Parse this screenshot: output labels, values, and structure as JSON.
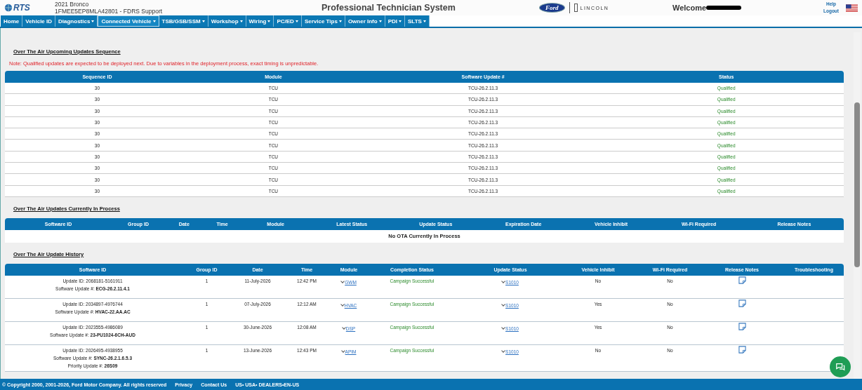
{
  "header": {
    "logo": "RTS",
    "vehicle": "2021 Bronco",
    "vin_line": "1FMEE5EP8MLA42801 - FDRS Support",
    "title": "Professional Technician System",
    "brand_1": "Ford",
    "brand_2": "LINCOLN",
    "welcome": "Welcome",
    "links": [
      "Help",
      "Logout"
    ]
  },
  "nav": [
    {
      "label": "Home",
      "has_menu": false,
      "selected": false
    },
    {
      "label": "Vehicle ID",
      "has_menu": false,
      "selected": false
    },
    {
      "label": "Diagnostics",
      "has_menu": true,
      "selected": false
    },
    {
      "label": "Connected Vehicle",
      "has_menu": true,
      "selected": true
    },
    {
      "label": "TSB/GSB/SSM",
      "has_menu": true,
      "selected": false
    },
    {
      "label": "Workshop",
      "has_menu": true,
      "selected": false
    },
    {
      "label": "Wiring",
      "has_menu": true,
      "selected": false
    },
    {
      "label": "PC/ED",
      "has_menu": true,
      "selected": false
    },
    {
      "label": "Service Tips",
      "has_menu": true,
      "selected": false
    },
    {
      "label": "Owner Info",
      "has_menu": true,
      "selected": false
    },
    {
      "label": "PDI",
      "has_menu": true,
      "selected": false
    },
    {
      "label": "SLTS",
      "has_menu": true,
      "selected": false
    }
  ],
  "upcoming": {
    "heading": "Over The Air Upcoming Updates Sequence",
    "note": "Note: Qualified updates are expected to be deployed next. Due to variables in the deployment process, exact timing is unpredictable.",
    "columns": [
      "Sequence ID",
      "Module",
      "Software Update #",
      "Status"
    ],
    "rows": [
      [
        "30",
        "TCU",
        "TCU-26.2.11.3",
        "Qualified"
      ],
      [
        "30",
        "TCU",
        "TCU-26.2.11.3",
        "Qualified"
      ],
      [
        "30",
        "TCU",
        "TCU-26.2.11.3",
        "Qualified"
      ],
      [
        "30",
        "TCU",
        "TCU-26.2.11.3",
        "Qualified"
      ],
      [
        "30",
        "TCU",
        "TCU-26.2.11.3",
        "Qualified"
      ],
      [
        "30",
        "TCU",
        "TCU-26.2.11.3",
        "Qualified"
      ],
      [
        "30",
        "TCU",
        "TCU-26.2.11.3",
        "Qualified"
      ],
      [
        "30",
        "TCU",
        "TCU-26.2.11.3",
        "Qualified"
      ],
      [
        "30",
        "TCU",
        "TCU-26.2.11.3",
        "Qualified"
      ],
      [
        "30",
        "TCU",
        "TCU-26.2.11.3",
        "Qualified"
      ]
    ]
  },
  "in_process": {
    "heading": "Over The Air Updates Currently In Process",
    "columns": [
      "Software ID",
      "Group ID",
      "Date",
      "Time",
      "Module",
      "Latest Status",
      "Update Status",
      "Expiration Date",
      "Vehicle Inhibit",
      "Wi-Fi Required",
      "Release Notes"
    ],
    "empty_message": "No OTA Currently In Process"
  },
  "history": {
    "heading": "Over The Air Update History",
    "columns": [
      "Software ID",
      "Group ID",
      "Date",
      "Time",
      "Module",
      "Completion Status",
      "Update Status",
      "Vehicle Inhibit",
      "Wi-Fi Required",
      "Release Notes",
      "Troubleshooting"
    ],
    "rows": [
      {
        "software": [
          "Update ID: 2068181-5161911",
          "Software Update #: **ECG-26.2.11.4.1**"
        ],
        "group": "1",
        "date": "11-July-2026",
        "time": "12:42 PM",
        "module": "GWM",
        "completion": "Campaign Successful",
        "update_status": "S1010",
        "inhibit": "No",
        "wifi": "No"
      },
      {
        "software": [
          "Update ID: 2034897-4976744",
          "Software Update #: **HVAC-22.AA.AC**"
        ],
        "group": "1",
        "date": "07-July-2026",
        "time": "12:12 AM",
        "module": "HVAC",
        "completion": "Campaign Successful",
        "update_status": "S1010",
        "inhibit": "Yes",
        "wifi": "No"
      },
      {
        "software": [
          "Update ID: 2023555-4986089",
          "Software Update #: **23-PU1024-6CH-AUD**"
        ],
        "group": "1",
        "date": "30-June-2026",
        "time": "12:08 AM",
        "module": "DSP",
        "completion": "Campaign Successful",
        "update_status": "S1010",
        "inhibit": "Yes",
        "wifi": "No"
      },
      {
        "software": [
          "Update ID: 2026495-4938955",
          "Software Update #: **SYNC-26.2.1.6.5.3**",
          "Priority Update #: **26S09**"
        ],
        "group": "1",
        "date": "13-June-2026",
        "time": "12:43 PM",
        "module": "APIM",
        "completion": "Campaign Successful",
        "update_status": "S1010",
        "inhibit": "No",
        "wifi": "No"
      }
    ]
  },
  "footer": {
    "copyright": "© Copyright 2000, 2001-2026, Ford Motor Company. All rights reserved",
    "links": [
      "Privacy",
      "Contact Us"
    ],
    "locale": "US• USA• DEALERS•EN-US"
  }
}
